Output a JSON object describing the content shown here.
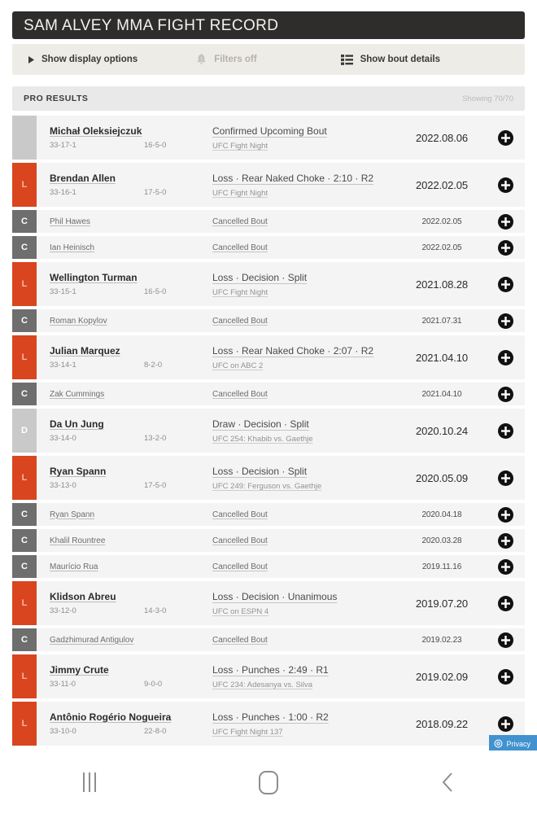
{
  "header": {
    "title": "SAM ALVEY MMA FIGHT RECORD"
  },
  "toolbar": {
    "display_options_label": "Show display options",
    "display_options_icon": "triangle-right-icon",
    "filters_label": "Filters off",
    "filters_icon": "filter-bell-icon",
    "bout_details_label": "Show bout details",
    "bout_details_icon": "list-icon"
  },
  "results_header": {
    "label": "PRO RESULTS",
    "showing": "Showing 70/70"
  },
  "colors": {
    "title_bar": "#2e2d2b",
    "toolbar_bg": "#eeece6",
    "loss_badge": "#d9451f",
    "cancelled_badge": "#6e6e6e",
    "draw_badge": "#c9c9c9",
    "upcoming_badge": "#c9c9c9",
    "row_bg": "#f4f4f4",
    "privacy_blue": "#4292cf"
  },
  "rows": [
    {
      "badge": "",
      "badge_type": "upcoming",
      "size": "tall",
      "opponent": "Michał Oleksiejczuk",
      "record_self": "33-17-1",
      "record_opp": "16-5-0",
      "method": "Confirmed Upcoming Bout",
      "event": "UFC Fight Night",
      "date": "2022.08.06"
    },
    {
      "badge": "L",
      "badge_type": "loss",
      "size": "tall",
      "opponent": "Brendan Allen",
      "record_self": "33-16-1",
      "record_opp": "17-5-0",
      "method": "Loss · Rear Naked Choke · 2:10 · R2",
      "event": "UFC Fight Night",
      "date": "2022.02.05"
    },
    {
      "badge": "C",
      "badge_type": "cancelled",
      "size": "short",
      "opponent": "Phil Hawes",
      "record_self": "",
      "record_opp": "",
      "method": "Cancelled Bout",
      "event": "",
      "date": "2022.02.05"
    },
    {
      "badge": "C",
      "badge_type": "cancelled",
      "size": "short",
      "opponent": "Ian Heinisch",
      "record_self": "",
      "record_opp": "",
      "method": "Cancelled Bout",
      "event": "",
      "date": "2022.02.05"
    },
    {
      "badge": "L",
      "badge_type": "loss",
      "size": "tall",
      "opponent": "Wellington Turman",
      "record_self": "33-15-1",
      "record_opp": "16-5-0",
      "method": "Loss · Decision · Split",
      "event": "UFC Fight Night",
      "date": "2021.08.28"
    },
    {
      "badge": "C",
      "badge_type": "cancelled",
      "size": "short",
      "opponent": "Roman Kopylov",
      "record_self": "",
      "record_opp": "",
      "method": "Cancelled Bout",
      "event": "",
      "date": "2021.07.31"
    },
    {
      "badge": "L",
      "badge_type": "loss",
      "size": "tall",
      "opponent": "Julian Marquez",
      "record_self": "33-14-1",
      "record_opp": "8-2-0",
      "method": "Loss · Rear Naked Choke · 2:07 · R2",
      "event": "UFC on ABC 2",
      "date": "2021.04.10"
    },
    {
      "badge": "C",
      "badge_type": "cancelled",
      "size": "short",
      "opponent": "Zak Cummings",
      "record_self": "",
      "record_opp": "",
      "method": "Cancelled Bout",
      "event": "",
      "date": "2021.04.10"
    },
    {
      "badge": "D",
      "badge_type": "draw",
      "size": "tall",
      "opponent": "Da Un Jung",
      "record_self": "33-14-0",
      "record_opp": "13-2-0",
      "method": "Draw · Decision · Split",
      "event": "UFC 254: Khabib vs. Gaethje",
      "date": "2020.10.24"
    },
    {
      "badge": "L",
      "badge_type": "loss",
      "size": "tall",
      "opponent": "Ryan Spann",
      "record_self": "33-13-0",
      "record_opp": "17-5-0",
      "method": "Loss · Decision · Split",
      "event": "UFC 249: Ferguson vs. Gaethje",
      "date": "2020.05.09"
    },
    {
      "badge": "C",
      "badge_type": "cancelled",
      "size": "short",
      "opponent": "Ryan Spann",
      "record_self": "",
      "record_opp": "",
      "method": "Cancelled Bout",
      "event": "",
      "date": "2020.04.18"
    },
    {
      "badge": "C",
      "badge_type": "cancelled",
      "size": "short",
      "opponent": "Khalil Rountree",
      "record_self": "",
      "record_opp": "",
      "method": "Cancelled Bout",
      "event": "",
      "date": "2020.03.28"
    },
    {
      "badge": "C",
      "badge_type": "cancelled",
      "size": "short",
      "opponent": "Maurício Rua",
      "record_self": "",
      "record_opp": "",
      "method": "Cancelled Bout",
      "event": "",
      "date": "2019.11.16"
    },
    {
      "badge": "L",
      "badge_type": "loss",
      "size": "tall",
      "opponent": "Klidson Abreu",
      "record_self": "33-12-0",
      "record_opp": "14-3-0",
      "method": "Loss · Decision · Unanimous",
      "event": "UFC on ESPN 4",
      "date": "2019.07.20"
    },
    {
      "badge": "C",
      "badge_type": "cancelled",
      "size": "short",
      "opponent": "Gadzhimurad Antigulov",
      "record_self": "",
      "record_opp": "",
      "method": "Cancelled Bout",
      "event": "",
      "date": "2019.02.23"
    },
    {
      "badge": "L",
      "badge_type": "loss",
      "size": "tall",
      "opponent": "Jimmy Crute",
      "record_self": "33-11-0",
      "record_opp": "9-0-0",
      "method": "Loss · Punches · 2:49 · R1",
      "event": "UFC 234: Adesanya vs. Silva",
      "date": "2019.02.09"
    },
    {
      "badge": "L",
      "badge_type": "loss",
      "size": "tall",
      "opponent": "Antônio Rogério Nogueira",
      "record_self": "33-10-0",
      "record_opp": "22-8-0",
      "method": "Loss · Punches · 1:00 · R2",
      "event": "UFC Fight Night 137",
      "date": "2018.09.22"
    }
  ],
  "privacy": {
    "label": "Privacy",
    "icon": "gear-icon"
  },
  "navbar": {
    "recents_label": "recents-icon",
    "home_label": "home-icon",
    "back_label": "back-icon"
  }
}
